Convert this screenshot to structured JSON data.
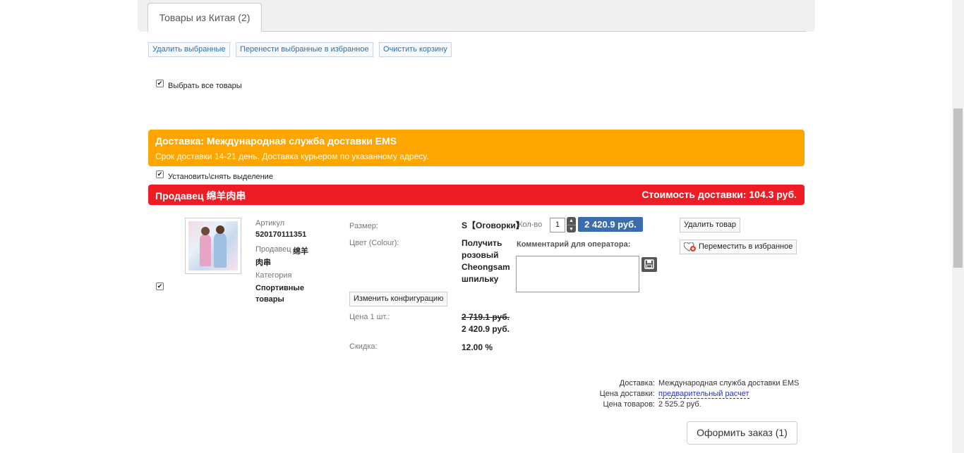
{
  "tabs": [
    {
      "label": "Товары из Китая (2)"
    }
  ],
  "toolbar": {
    "delete_selected": "Удалить выбранные",
    "move_to_favorites": "Перенести выбранные в избранное",
    "clear_cart": "Очистить корзину"
  },
  "select_all_label": "Выбрать все товары",
  "delivery": {
    "title": "Доставка: Международная служба доставки EMS",
    "subtitle": "Срок доставки 14-21 день. Доставка курьером по указанному адресу.",
    "toggle_selection_label": "Установить\\снять выделение"
  },
  "seller_bar": {
    "seller": "Продавец 绵羊肉串",
    "shipping_cost": "Стоимость доставки: 104.3 руб."
  },
  "item": {
    "article_label": "Артикул",
    "article_value": "520170111351",
    "seller_label": "Продавец",
    "seller_value": "绵羊",
    "seller_value_2": "肉串",
    "category_label": "Категория",
    "category_value": "Спортивные товары",
    "size_label": "Размер:",
    "size_value": "S【Оговорки】",
    "color_label": "Цвет (Colour):",
    "color_value": "Получить розовый Cheongsam шпильку",
    "change_config": "Изменить конфигурацию",
    "unit_price_label": "Цена 1 шт.:",
    "unit_price_old": "2 719.1 руб.",
    "unit_price_new": "2 420.9 руб.",
    "discount_label": "Скидка:",
    "discount_value": "12.00 %",
    "qty_label": "Кол-во:",
    "qty_value": "1",
    "total_price": "2 420.9 руб.",
    "comment_label": "Комментарий для оператора:",
    "delete_item": "Удалить товар",
    "move_item_favorites": "Переместить в избранное"
  },
  "summary": {
    "delivery_label": "Доставка:",
    "delivery_value": "Международная служба доставки EMS",
    "delivery_price_label": "Цена доставки:",
    "delivery_price_value": "предварительный расчет",
    "goods_price_label": "Цена товаров:",
    "goods_price_value": "2 525.2 руб."
  },
  "order_button": "Оформить заказ (1)",
  "colors": {
    "delivery_bar": "#ffa500",
    "seller_bar": "#ee1c25",
    "price_badge": "#3a6db0"
  }
}
